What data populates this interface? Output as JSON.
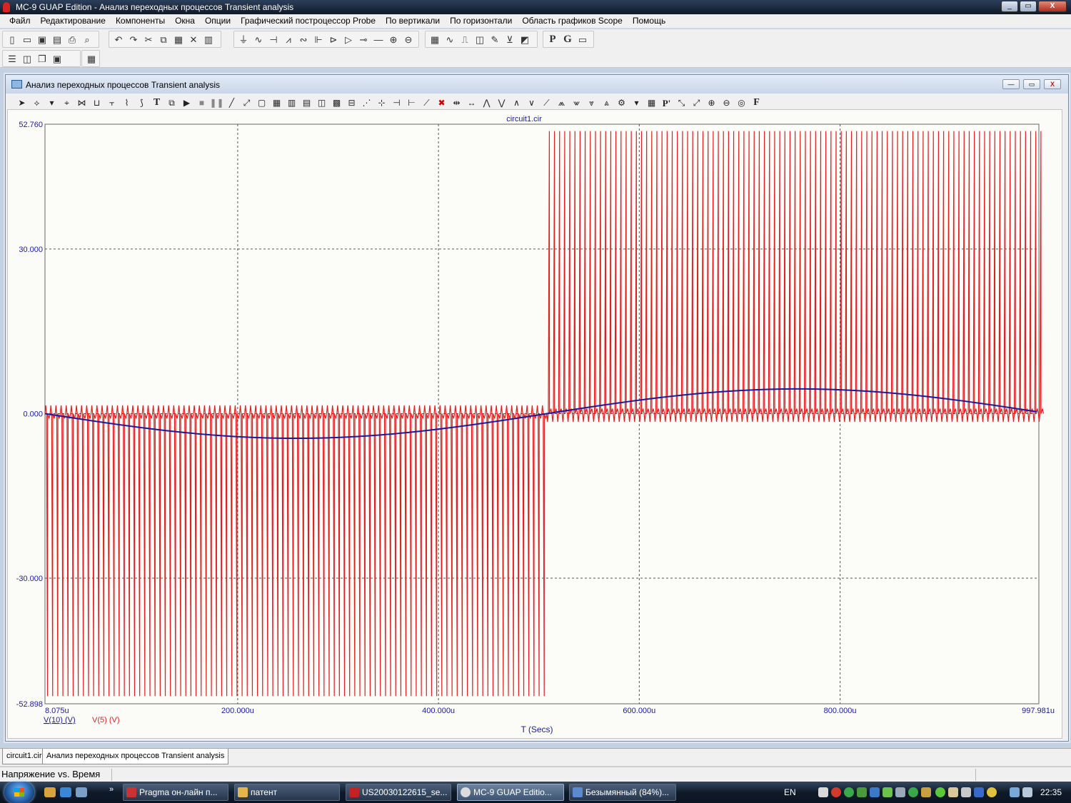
{
  "app": {
    "title": "MC-9 GUAP Edition - Анализ переходных процессов Transient analysis",
    "window_buttons": [
      "_",
      "▭",
      "X"
    ]
  },
  "menubar": {
    "items": [
      "Файл",
      "Редактирование",
      "Компоненты",
      "Окна",
      "Опции",
      "Графический построцессор Probe",
      "По вертикали",
      "По горизонтали",
      "Область графиков Scope",
      "Помощь"
    ]
  },
  "toolbar": {
    "file_icons": [
      "new-file-icon",
      "open-folder-icon",
      "save-icon",
      "save-all-icon",
      "print-icon",
      "print-preview-icon"
    ],
    "edit_icons": [
      "undo-icon",
      "redo-icon",
      "cut-icon",
      "copy-icon",
      "paste-icon",
      "delete-icon",
      "select-all-icon"
    ],
    "component_icons": [
      "ground-icon",
      "sine-source-icon",
      "capacitor-icon",
      "resistor-icon",
      "inductor-icon",
      "battery-icon",
      "diode-icon",
      "opamp-icon",
      "switch-icon",
      "wire-icon",
      "node-icon",
      "current-source-icon"
    ],
    "probe_icons": [
      "grid-select-icon",
      "waveform-icon",
      "step-icon",
      "scope-icon",
      "probe-pen-icon",
      "vx-icon",
      "graph-icon"
    ],
    "text_buttons": [
      "P",
      "G"
    ],
    "window_icons": [
      "tile-horizontal-icon",
      "tile-vertical-icon",
      "cascade-icon",
      "arrange-icon",
      "calculator-icon"
    ]
  },
  "subwindow": {
    "title": "Анализ переходных процессов Transient analysis",
    "buttons": [
      "—",
      "▭",
      "X"
    ]
  },
  "plot_toolbar": {
    "icons": [
      "pointer-icon",
      "select-icon",
      "dropdown-icon",
      "tag-icon",
      "point-tag-icon",
      "horizontal-tag-icon",
      "vertical-tag-icon",
      "difference-tag-icon",
      "performance-tag-icon",
      "text-icon",
      "properties-icon",
      "run-icon",
      "stop-icon",
      "pause-icon",
      "line-icon",
      "diagonal-icon",
      "axes-icon",
      "grid-icon",
      "minor-grid-icon",
      "horizontal-grid-icon",
      "vertical-grid-icon",
      "bold-grid-icon",
      "same-y-icon",
      "tokens-icon",
      "data-points-icon",
      "left-cursor-icon",
      "right-cursor-icon",
      "slope-icon",
      "clear-icon",
      "cursor-mode-icon",
      "next-cursor-icon",
      "peak-icon",
      "valley-icon",
      "high-icon",
      "low-icon",
      "inflection-icon",
      "global-high-icon",
      "global-low-icon",
      "top-icon",
      "bottom-icon",
      "animate-icon",
      "settings-dropdown-icon",
      "numeric-output-icon",
      "probe-text-icon",
      "zoom-region-icon",
      "scale-icon",
      "zoom-in-icon",
      "zoom-out-icon",
      "color-icon",
      "font-icon"
    ],
    "text_buttons": [
      "T",
      "P'",
      "F"
    ]
  },
  "chart_data": {
    "type": "line",
    "title": "circuit1.cir",
    "xlabel": "T (Secs)",
    "ylabel": "",
    "xlim": [
      8.075,
      997.981
    ],
    "ylim": [
      -52.898,
      52.76
    ],
    "x_unit": "u",
    "x_tick_labels": [
      "8.075u",
      "200.000u",
      "400.000u",
      "600.000u",
      "800.000u",
      "997.981u"
    ],
    "x_gridlines": [
      200,
      400,
      600,
      800
    ],
    "y_tick_labels": [
      "52.760",
      "30.000",
      "0.000",
      "-30.000",
      "-52.898"
    ],
    "y_gridlines": [
      30,
      0,
      -30
    ],
    "grid": true,
    "legend_location": "below the x-axis, bottom-left",
    "series": [
      {
        "name": "V(10) (V)",
        "color": "#1a1aa0",
        "waveform": "sine",
        "amplitude": 4.5,
        "period_us": 1000,
        "phase": "negative half first (min near 250u, zero crossing near 505u, max near 750u)"
      },
      {
        "name": "V(5) (V)",
        "color": "#e02020",
        "waveform": "pulse train",
        "spike_period_us": 5.1,
        "spikes_before_crossing_to": -51.5,
        "spikes_after_crossing_to": 51.5,
        "baseline_ripple": 1.5,
        "crossing_us": 505
      }
    ]
  },
  "tabs": [
    "circuit1.cir",
    "Анализ переходных процессов Transient analysis"
  ],
  "status": {
    "text": "Напряжение vs. Время"
  },
  "taskbar": {
    "tasks": [
      "Pragma он-лайн п...",
      "патент",
      "US20030122615_se...",
      "MC-9 GUAP Editio...",
      "Безымянный (84%)..."
    ],
    "language": "EN",
    "clock": "22:35",
    "overflow": "»"
  }
}
